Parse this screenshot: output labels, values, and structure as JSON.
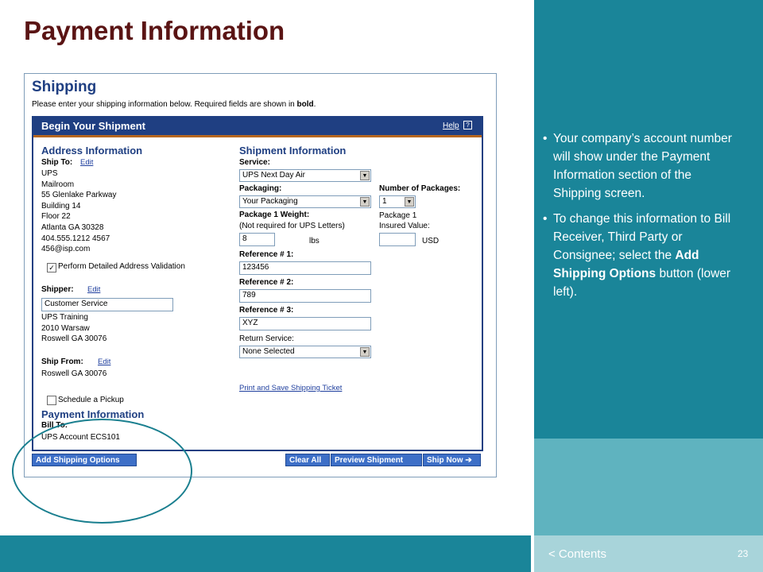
{
  "slide": {
    "title": "Payment Information",
    "bullet_1": "Your company’s account number will show under the Payment Information section of the Shipping screen.",
    "bullet_2_prefix": "To change this information to Bill Receiver, Third Party or Consignee; select the ",
    "bullet_2_bold": "Add Shipping Options",
    "bullet_2_suffix": " button (lower left).",
    "bullet_glyph": "•",
    "contents_link": "< Contents",
    "page_number": "23"
  },
  "shipping": {
    "heading": "Shipping",
    "instructions_prefix": "Please enter your shipping information below.  Required fields are shown in ",
    "instructions_bold": "bold",
    "instructions_suffix": ".",
    "panel_title": "Begin Your Shipment",
    "help_link": "Help",
    "help_icon_glyph": "?",
    "address": {
      "title": "Address Information",
      "ship_to_label": "Ship To:",
      "edit_link": "Edit",
      "ship_to_lines": [
        "UPS",
        "Mailroom",
        "55 Glenlake Parkway",
        "Building 14",
        "Floor 22",
        "Atlanta GA 30328",
        "404.555.1212 4567",
        "456@isp.com"
      ],
      "validation_checkbox_label": "Perform Detailed Address Validation",
      "validation_checked": true,
      "shipper_label": "Shipper:",
      "shipper_value": "Customer Service",
      "shipper_lines": [
        "UPS Training",
        "2010 Warsaw",
        "Roswell GA 30076"
      ],
      "ship_from_label": "Ship From:",
      "ship_from_lines": [
        "Roswell GA 30076"
      ],
      "pickup_checkbox_label": "Schedule a Pickup",
      "pickup_checked": false
    },
    "payment": {
      "title": "Payment Information",
      "bill_to_label": "Bill To:",
      "bill_to_value": "UPS Account ECS101"
    },
    "shipment": {
      "title": "Shipment Information",
      "service_label": "Service:",
      "service_value": "UPS Next Day Air",
      "packaging_label": "Packaging:",
      "packaging_value": "Your Packaging",
      "num_packages_label": "Number of Packages:",
      "num_packages_value": "1",
      "weight_label": "Package 1 Weight:",
      "weight_note": "(Not required for UPS Letters)",
      "weight_value": "8",
      "weight_unit": "lbs",
      "package_label": "Package 1",
      "insured_label": "Insured Value:",
      "insured_value": "",
      "insured_unit": "USD",
      "ref1_label": "Reference # 1:",
      "ref1_value": "123456",
      "ref2_label": "Reference # 2:",
      "ref2_value": "789",
      "ref3_label": "Reference # 3:",
      "ref3_value": "XYZ",
      "return_label": "Return Service:",
      "return_value": "None Selected",
      "print_link": "Print and Save Shipping Ticket"
    },
    "buttons": {
      "add_options": "Add Shipping Options",
      "clear_all": "Clear All",
      "preview": "Preview Shipment",
      "ship_now": "Ship Now",
      "ship_now_arrow": "➔"
    },
    "colors": {
      "nav_blue": "#1f3f82",
      "button_blue": "#3d6fc7",
      "accent_orange": "#b5661f"
    }
  },
  "theme": {
    "teal": "#1a8599",
    "teal_light": "#5fb3bf",
    "title_color": "#5a1414"
  }
}
